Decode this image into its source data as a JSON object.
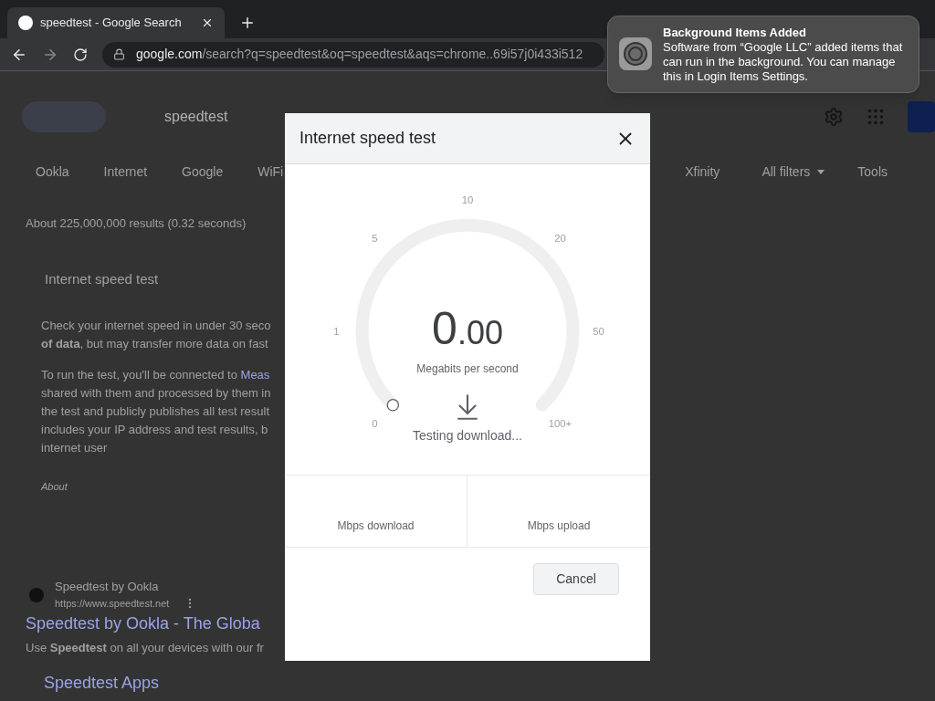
{
  "browser": {
    "tab": {
      "title": "speedtest - Google Search",
      "selected": true
    },
    "url_host": "google.com",
    "url_path": "/search?q=speedtest&oq=speedtest&aqs=chrome..69i57j0i433i512"
  },
  "search": {
    "query": "speedtest"
  },
  "chips": [
    {
      "label": "Ookla"
    },
    {
      "label": "Internet"
    },
    {
      "label": "Google"
    },
    {
      "label": "WiFi"
    }
  ],
  "chips_right": [
    {
      "label": "Xfinity"
    }
  ],
  "filters": {
    "all_filters": "All filters",
    "tools": "Tools"
  },
  "result_stats": "About 225,000,000 results (0.32 seconds)",
  "feature": {
    "title": "Internet speed test",
    "p1": [
      "Check your internet speed in under 30 seco",
      "**of data**, but may transfer more data on fast"
    ],
    "p2_first": "To run the test, you'll be connected to ",
    "p2_link": "Meas",
    "p2_rest": [
      "shared with them and processed by them in",
      "the test and publicly publishes all test result",
      "includes your IP address and test results, b",
      "internet user"
    ],
    "about": "About"
  },
  "result": {
    "site": "Speedtest by Ookla",
    "url": "https://www.speedtest.net",
    "title": "Speedtest by Ookla - The Globa",
    "snippet": "Use **Speedtest** on all your devices with our fr",
    "sublink": "Speedtest Apps"
  },
  "dialog": {
    "title": "Internet speed test",
    "gauge": {
      "ticks": [
        "0",
        "1",
        "5",
        "10",
        "20",
        "50",
        "100+"
      ]
    },
    "value_int": "0",
    "value_dec": ".00",
    "unit": "Megabits per second",
    "status": "Testing download...",
    "results": [
      {
        "label": "Mbps download"
      },
      {
        "label": "Mbps upload"
      }
    ],
    "cancel": "Cancel"
  },
  "notification": {
    "title": "Background Items Added",
    "body": "Software from “Google LLC” added items that can run in the background. You can manage this in Login Items Settings."
  }
}
